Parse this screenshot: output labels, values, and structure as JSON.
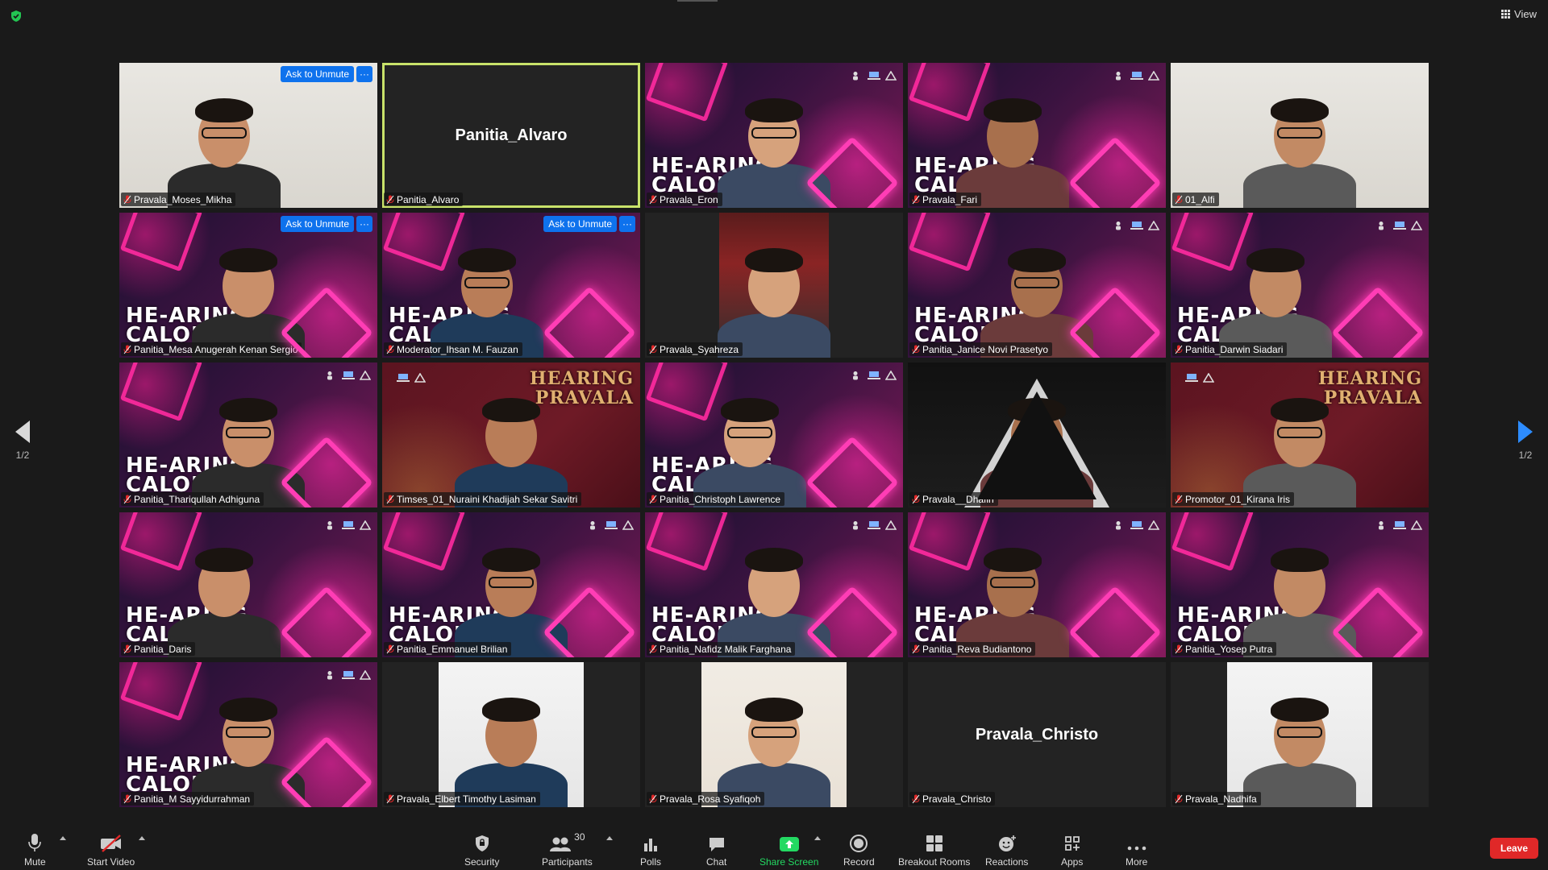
{
  "window": {
    "view_label": "View"
  },
  "tiles": [
    {
      "name": "Pravala_Moses_Mikha",
      "bg": "bg-room",
      "ask": true
    },
    {
      "name": "Panitia_Alvaro",
      "center": "Panitia_Alvaro",
      "active": true
    },
    {
      "name": "Pravala_Eron",
      "bg": "bg-stage",
      "hearing": true,
      "icons": true
    },
    {
      "name": "Pravala_Fari",
      "bg": "bg-stage",
      "hearing": true,
      "icons": true
    },
    {
      "name": "01_Alfi",
      "bg": "bg-room"
    },
    {
      "name": "Panitia_Mesa Anugerah Kenan Sergio",
      "bg": "bg-stage",
      "hearing": true,
      "ask": true
    },
    {
      "name": "Moderator_Ihsan M. Fauzan",
      "bg": "bg-stage",
      "hearing": true,
      "ask": true
    },
    {
      "name": "Pravala_Syahreza",
      "pillar": "bus"
    },
    {
      "name": "Panitia_Janice Novi Prasetyo",
      "bg": "bg-stage",
      "hearing": true,
      "icons": true
    },
    {
      "name": "Panitia_Darwin Siadari",
      "bg": "bg-stage",
      "hearing": true,
      "icons": true
    },
    {
      "name": "Panitia_Thariqullah Adhiguna",
      "bg": "bg-stage",
      "hearing": true,
      "icons": true
    },
    {
      "name": "Timses_01_Nuraini Khadijah Sekar Savitri",
      "bg": "bg-maroon",
      "hearing_right": true,
      "icons_left": true
    },
    {
      "name": "Panitia_Christoph Lawrence",
      "bg": "bg-stage",
      "hearing": true,
      "icons": true
    },
    {
      "name": "Pravala__Dhafin",
      "bg": "bg-dark"
    },
    {
      "name": "Promotor_01_Kirana Iris",
      "bg": "bg-maroon",
      "hearing_right": true,
      "icons_left": true
    },
    {
      "name": "Panitia_Daris",
      "bg": "bg-stage",
      "hearing": true,
      "icons": true
    },
    {
      "name": "Panitia_Emmanuel Brilian",
      "bg": "bg-stage",
      "hearing": true,
      "icons": true
    },
    {
      "name": "Panitia_Nafidz Malik Farghana",
      "bg": "bg-stage",
      "hearing": true,
      "icons": true
    },
    {
      "name": "Panitia_Reva Budiantono",
      "bg": "bg-stage",
      "hearing": true,
      "icons": true
    },
    {
      "name": "Panitia_Yosep Putra",
      "bg": "bg-stage",
      "hearing": true,
      "icons": true
    },
    {
      "name": "Panitia_M Sayyidurrahman",
      "bg": "bg-stage",
      "hearing": true,
      "icons": true
    },
    {
      "name": "Pravala_Elbert Timothy Lasiman",
      "pillar": "white"
    },
    {
      "name": "Pravala_Rosa Syafiqoh",
      "pillar": "cream"
    },
    {
      "name": "Pravala_Christo",
      "center": "Pravala_Christo"
    },
    {
      "name": "Pravala_Nadhifa",
      "pillar": "white"
    }
  ],
  "labels": {
    "ask_to_unmute": "Ask to Unmute",
    "more_dots": "···",
    "hearing_line1": "HE-ARING",
    "hearing_line2": "CALON K",
    "hearing_right_line1": "HEARING",
    "hearing_right_line2": "PRAVALA"
  },
  "pager": {
    "left": "1/2",
    "right": "1/2"
  },
  "toolbar": {
    "mute": "Mute",
    "start_video": "Start Video",
    "security": "Security",
    "participants": "Participants",
    "participants_count": "30",
    "polls": "Polls",
    "chat": "Chat",
    "share_screen": "Share Screen",
    "record": "Record",
    "breakout_rooms": "Breakout Rooms",
    "reactions": "Reactions",
    "apps": "Apps",
    "more": "More",
    "leave": "Leave"
  },
  "colors": {
    "accent_blue": "#0e72ed",
    "share_green": "#23d962",
    "leave_red": "#e02828",
    "active_speaker": "#c8e26a"
  }
}
